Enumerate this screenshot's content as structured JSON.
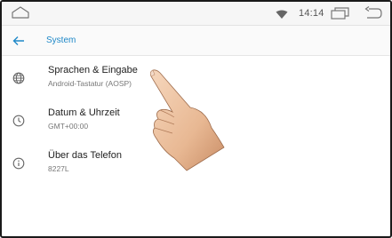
{
  "status_bar": {
    "time": "14:14"
  },
  "toolbar": {
    "title": "System"
  },
  "settings": [
    {
      "title": "Sprachen & Eingabe",
      "subtitle": "Android-Tastatur (AOSP)",
      "icon": "globe-icon"
    },
    {
      "title": "Datum & Uhrzeit",
      "subtitle": "GMT+00:00",
      "icon": "clock-icon"
    },
    {
      "title": "Über das Telefon",
      "subtitle": "8227L",
      "icon": "info-icon"
    }
  ],
  "colors": {
    "accent": "#1e88c8",
    "statusbar_bg": "#f6f6f6"
  }
}
